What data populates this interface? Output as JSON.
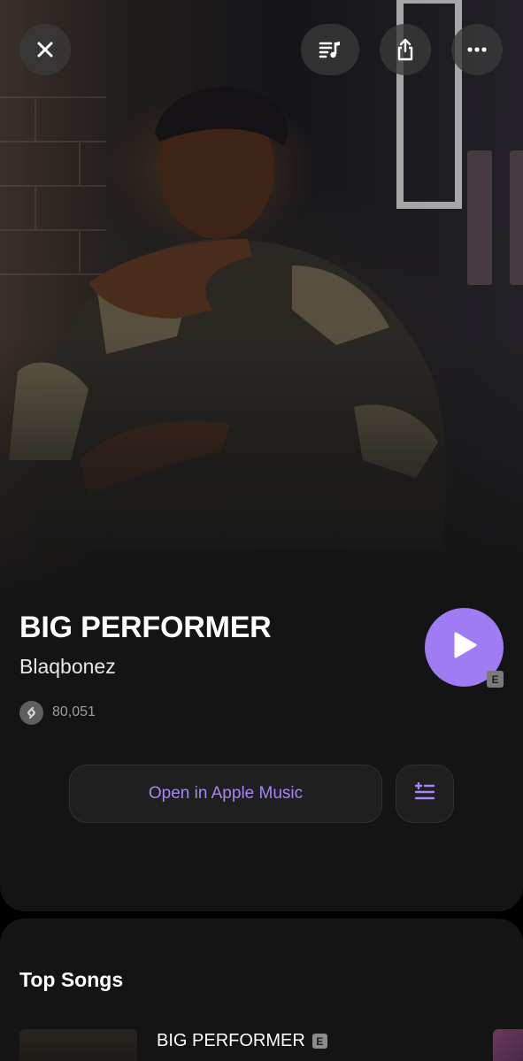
{
  "header": {
    "close_icon": "close-icon",
    "lyrics_icon": "lyrics-queue-icon",
    "share_icon": "share-icon",
    "more_icon": "more-icon"
  },
  "track": {
    "title": "BIG PERFORMER",
    "artist": "Blaqbonez",
    "shazam_count": "80,051",
    "explicit_badge": "E"
  },
  "actions": {
    "open_apple_music_label": "Open in Apple Music",
    "add_to_queue_icon": "add-to-queue-icon"
  },
  "top_songs": {
    "heading": "Top Songs",
    "items": [
      {
        "title": "BIG PERFORMER",
        "explicit_badge": "E"
      }
    ]
  },
  "colors": {
    "accent": "#9f7bf4",
    "accent_text": "#a885f7",
    "card_background": "#141414",
    "page_background": "#000000"
  }
}
